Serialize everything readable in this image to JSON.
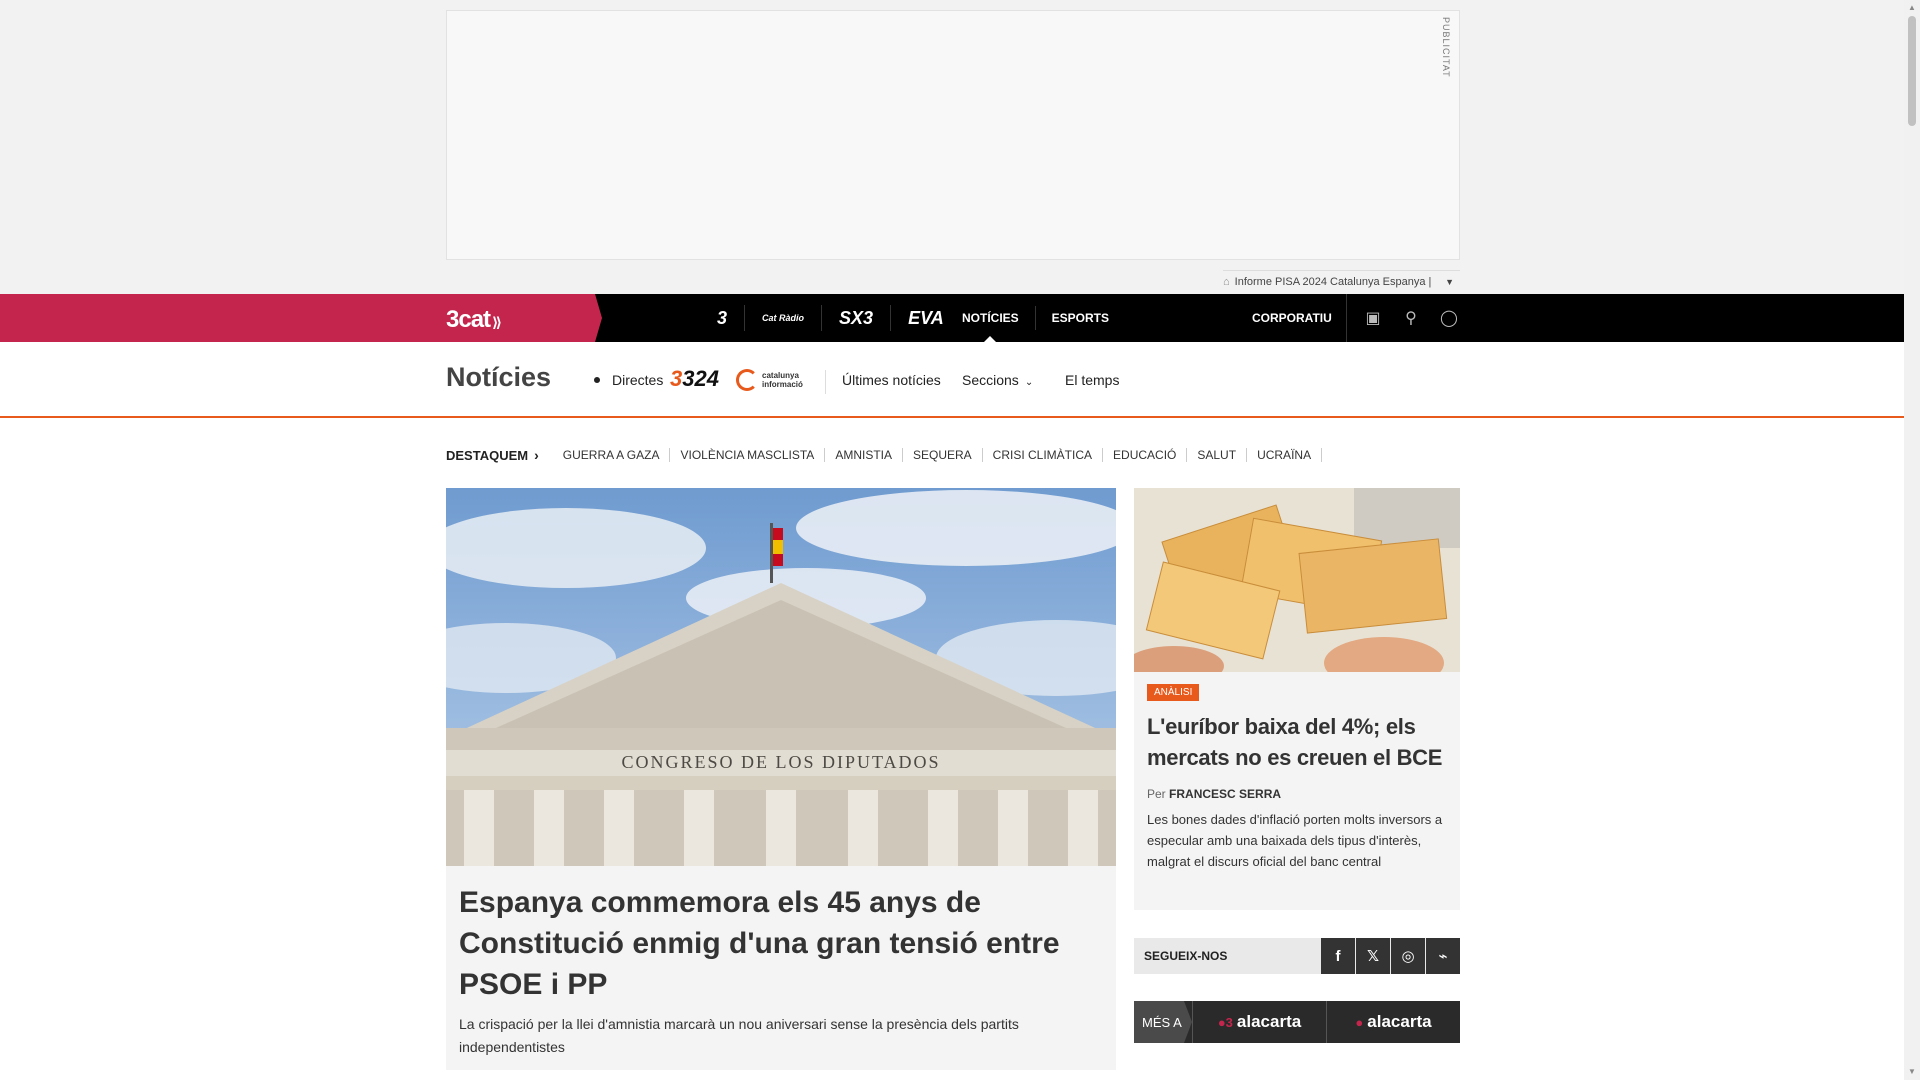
{
  "ad": {
    "label": "PUBLICITAT",
    "sub_text": "Informe PISA 2024 Catalunya Espanya |"
  },
  "topnav": {
    "brand": "3cat",
    "channels": [
      "3",
      "Cat Ràdio",
      "SX3",
      "EVA"
    ],
    "links": [
      "NOTÍCIES",
      "ESPORTS"
    ],
    "active_link": "NOTÍCIES",
    "corporate": "CORPORATIU",
    "icons": [
      "shop-icon",
      "search-icon",
      "user-icon"
    ]
  },
  "section": {
    "title": "Notícies",
    "directes": "Directes",
    "logo_324": "324",
    "logo_ci_line1": "catalunya",
    "logo_ci_line2": "informació",
    "ultimes": "Últimes notícies",
    "seccions": "Seccions",
    "eltemps": "El temps"
  },
  "destaquem": {
    "label": "DESTAQUEM",
    "items": [
      "GUERRA A GAZA",
      "VIOLÈNCIA MASCLISTA",
      "AMNISTIA",
      "SEQUERA",
      "CRISI CLIMÀTICA",
      "EDUCACIÓ",
      "SALUT",
      "UCRAÏNA"
    ]
  },
  "main_article": {
    "image_caption": "CONGRESO DE LOS DIPUTADOS",
    "title": "Espanya commemora els 45 anys de Constitució enmig d'una gran tensió entre PSOE i PP",
    "subtitle": "La crispació per la llei d'amnistia marcarà un nou aniversari sense la presència dels partits independentistes"
  },
  "side_article": {
    "badge": "ANÀLISI",
    "title": "L'euríbor baixa del 4%; els mercats no es creuen el BCE",
    "byline_prefix": "Per",
    "author": "FRANCESC SERRA",
    "description": "Les bones dades d'inflació porten molts inversors a especular amb una baixada dels tipus d'interès, malgrat el discurs oficial del banc central"
  },
  "follow": {
    "label": "SEGUEIX-NOS",
    "networks": [
      "facebook",
      "x",
      "instagram",
      "rss"
    ]
  },
  "mes_a": {
    "label": "MÉS A",
    "items": [
      "alacarta",
      "alacarta"
    ]
  },
  "colors": {
    "brand": "#c4254c",
    "accent": "#e85a1c",
    "nav_bg": "#000000"
  }
}
